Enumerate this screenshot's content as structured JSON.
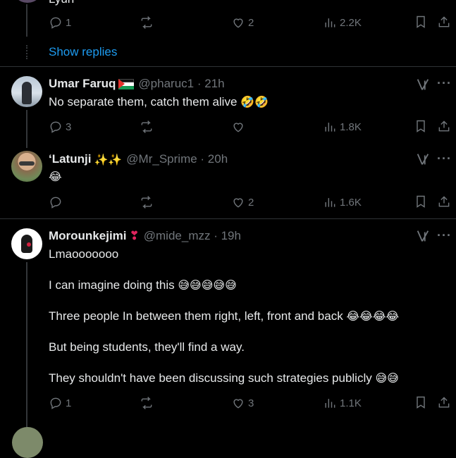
{
  "top": {
    "partial_text": "Lyun",
    "reply_count": "1",
    "like_count": "2",
    "view_count": "2.2K",
    "show_replies": "Show replies"
  },
  "replies": [
    {
      "name": "Umar Faruq",
      "handle": "@pharuc1 · 21h",
      "text": "No separate them, catch them alive",
      "emoji": "🤣🤣",
      "reply_count": "3",
      "like_count": "",
      "view_count": "1.8K"
    },
    {
      "name": "‘Latunji",
      "name_emoji": "✨✨",
      "handle": "@Mr_Sprime · 20h",
      "text": "",
      "emoji": "😂",
      "reply_count": "",
      "like_count": "2",
      "view_count": "1.6K"
    },
    {
      "name": "Morounkejimi",
      "name_emoji": "❣",
      "handle": "@mide_mzz · 19h",
      "lines": [
        {
          "text": "Lmaooooooo",
          "emoji": ""
        },
        {
          "text": "I can imagine doing this",
          "emoji": "😅😅😅😅😅"
        },
        {
          "text": "Three people In between them right, left, front and back",
          "emoji": "😂😂😂😂"
        },
        {
          "text": "But being students, they'll find a way.",
          "emoji": ""
        },
        {
          "text": "They shouldn't have been discussing such strategies publicly",
          "emoji": "😅😅"
        }
      ],
      "reply_count": "1",
      "like_count": "3",
      "view_count": "1.1K"
    }
  ],
  "icons": {
    "reply": "reply-icon",
    "repost": "repost-icon",
    "like": "like-icon",
    "views": "views-icon",
    "bookmark": "bookmark-icon",
    "share": "share-icon",
    "grok": "grok-icon",
    "more": "more-icon"
  },
  "colors": {
    "background": "#000000",
    "text": "#e7e9ea",
    "muted": "#71767b",
    "link": "#1d9bf0",
    "divider": "#2f3336"
  }
}
